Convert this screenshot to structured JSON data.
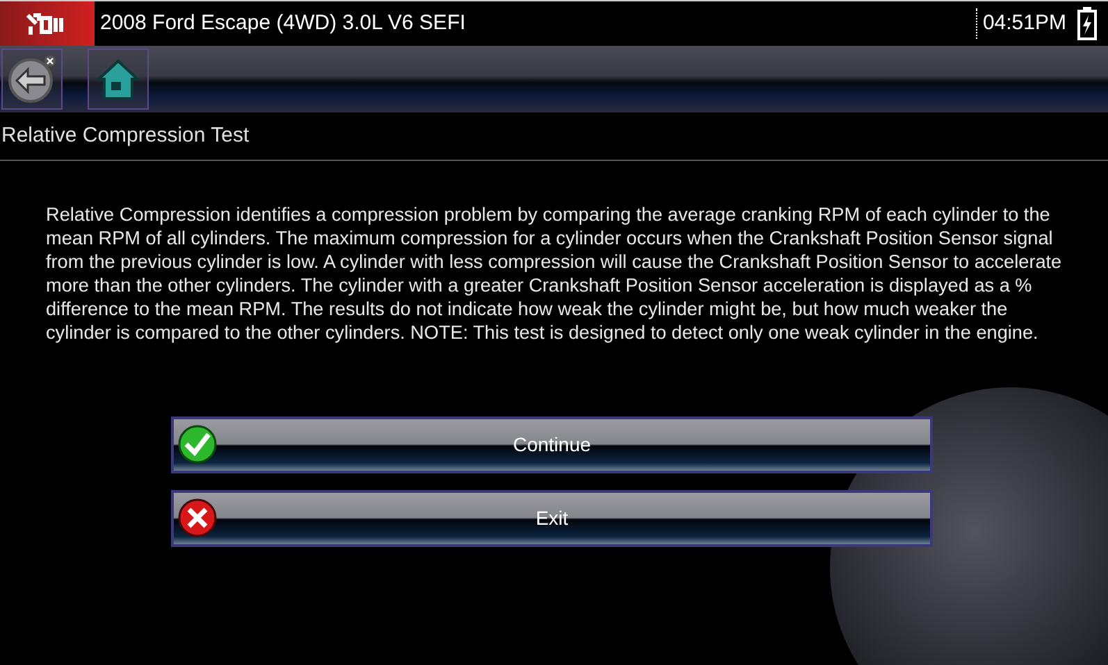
{
  "status_bar": {
    "vehicle": "2008 Ford Escape (4WD) 3.0L V6 SEFI",
    "time": "04:51PM"
  },
  "toolbar": {
    "buttons": [
      {
        "kind": "back"
      },
      {
        "kind": "home"
      }
    ]
  },
  "title": "Relative Compression Test",
  "description": "Relative Compression identifies a compression problem by comparing the average cranking RPM of each cylinder to the mean RPM of all cylinders. The maximum compression for a cylinder occurs when the Crankshaft Position Sensor signal from the previous cylinder is low. A cylinder with less compression will cause the Crankshaft Position Sensor to accelerate more than the other cylinders. The cylinder with a  greater Crankshaft Position Sensor acceleration is displayed as a %  difference to the mean RPM. The results do not indicate how weak the cylinder might be, but how much weaker the cylinder is compared to the other cylinders. NOTE: This test  is designed to detect only one weak cylinder in the engine.",
  "actions": [
    {
      "kind": "confirm",
      "label": "Continue"
    },
    {
      "kind": "cancel",
      "label": "Exit"
    }
  ]
}
